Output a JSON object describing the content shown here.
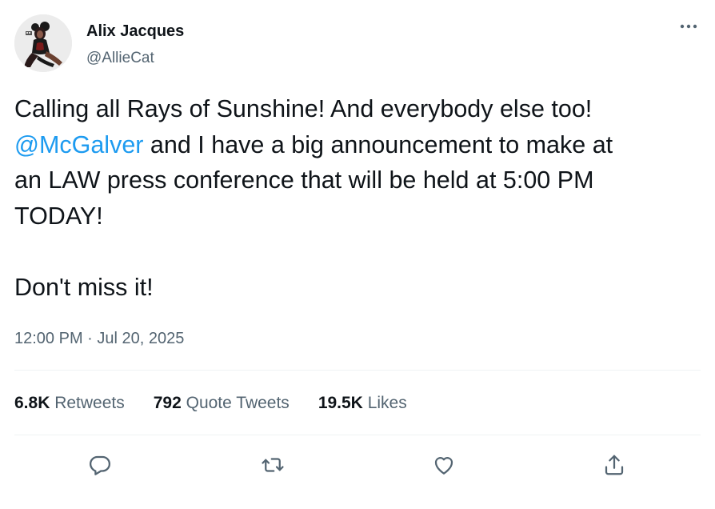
{
  "author": {
    "name": "Alix Jacques",
    "handle": "@AllieCat"
  },
  "tweet": {
    "line1": "Calling all Rays of Sunshine! And everybody else too!",
    "mention": "@McGalver",
    "line2_rest": " and I have a big announcement to make at",
    "line3": "an LAW press conference that will be held at 5:00 PM",
    "line4": "TODAY!",
    "line5": "Don't miss it!"
  },
  "meta": {
    "time": "12:00 PM",
    "separator": " · ",
    "date": "Jul 20, 2025"
  },
  "stats": {
    "retweets_count": "6.8K",
    "retweets_label": " Retweets",
    "quotes_count": "792",
    "quotes_label": " Quote Tweets",
    "likes_count": "19.5K",
    "likes_label": " Likes"
  },
  "icons": {
    "more": "more-horizontal-icon",
    "reply": "reply-bubble-icon",
    "retweet": "retweet-arrows-icon",
    "like": "heart-icon",
    "share": "share-upload-icon"
  },
  "colors": {
    "text": "#0f1419",
    "secondary": "#536471",
    "link": "#1d9bf0",
    "divider": "#eff3f4"
  }
}
